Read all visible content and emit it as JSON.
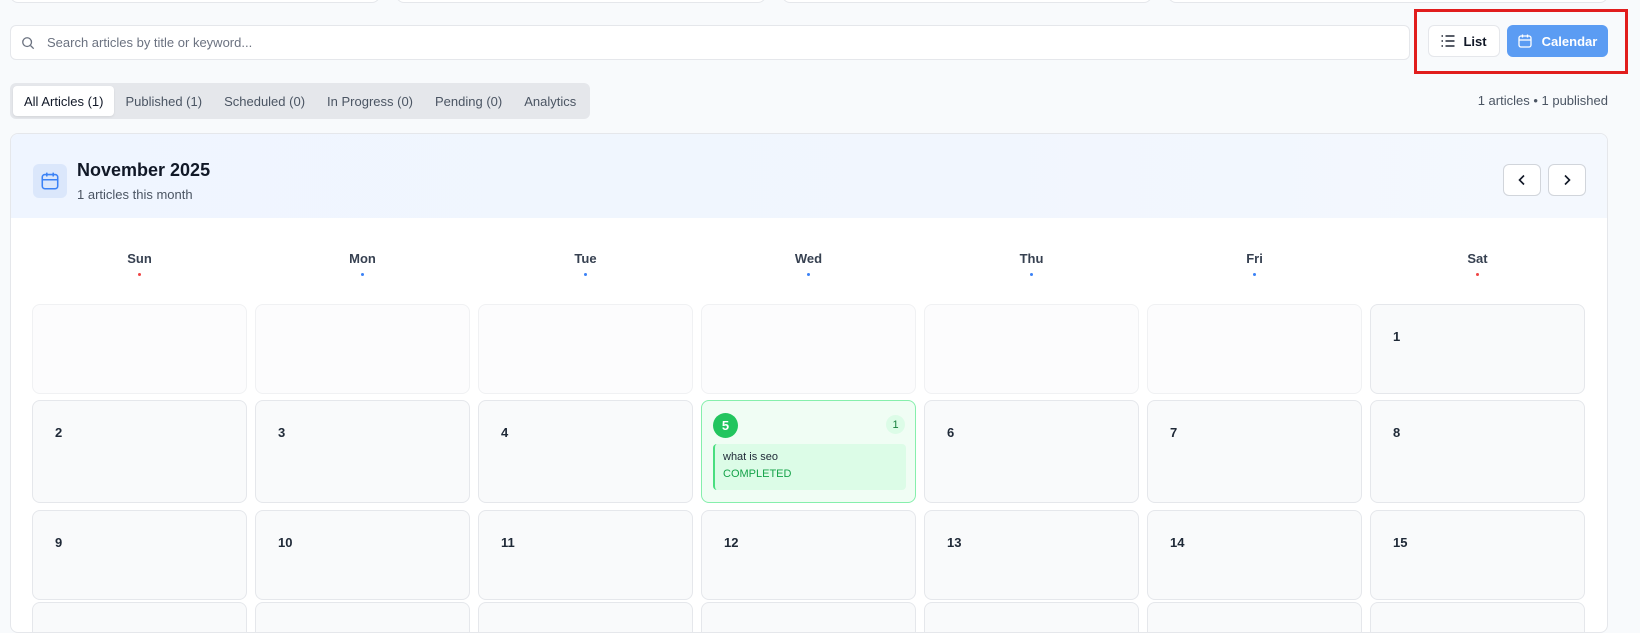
{
  "search": {
    "placeholder": "Search articles by title or keyword..."
  },
  "view_toggle": {
    "list_label": "List",
    "calendar_label": "Calendar",
    "active": "Calendar"
  },
  "tabs": [
    {
      "label": "All Articles (1)",
      "active": true
    },
    {
      "label": "Published (1)",
      "active": false
    },
    {
      "label": "Scheduled (0)",
      "active": false
    },
    {
      "label": "In Progress (0)",
      "active": false
    },
    {
      "label": "Pending (0)",
      "active": false
    },
    {
      "label": "Analytics",
      "active": false
    }
  ],
  "summary": "1 articles • 1 published",
  "calendar": {
    "title": "November 2025",
    "subtitle": "1 articles this month",
    "weekdays": [
      "Sun",
      "Mon",
      "Tue",
      "Wed",
      "Thu",
      "Fri",
      "Sat"
    ],
    "weekend_dot_color": "#ef4444",
    "weekday_dot_color": "#3b82f6",
    "accent_color": "#5b9cf3",
    "weeks": [
      [
        "",
        "",
        "",
        "",
        "",
        "",
        "1"
      ],
      [
        "2",
        "3",
        "4",
        "5",
        "6",
        "7",
        "8"
      ],
      [
        "9",
        "10",
        "11",
        "12",
        "13",
        "14",
        "15"
      ]
    ],
    "article_day": {
      "day": "5",
      "count": "1",
      "article_title": "what is seo",
      "article_status": "COMPLETED",
      "status_color": "#22c55e"
    }
  }
}
